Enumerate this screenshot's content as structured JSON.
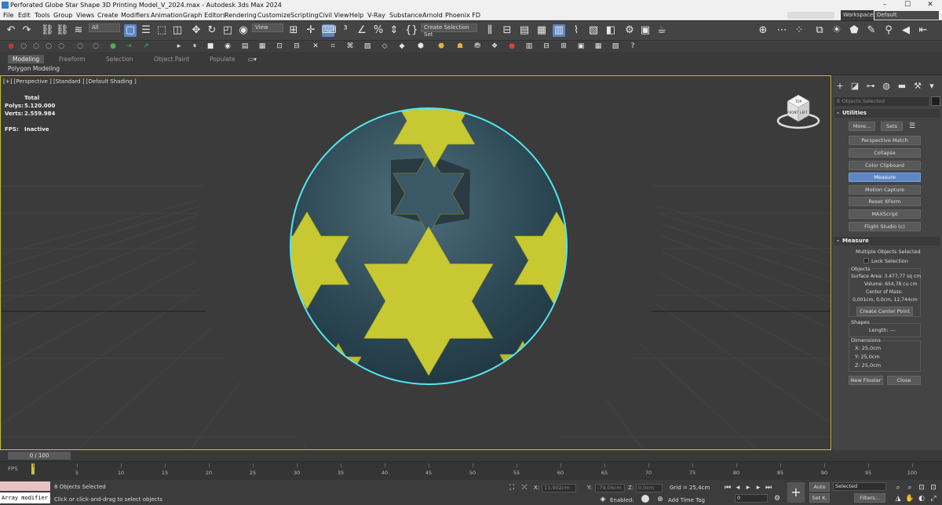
{
  "window": {
    "title": "Perforated Globe Star Shape 3D Printing Model_V_2024.max - Autodesk 3ds Max 2024",
    "controls": {
      "minimize": "–",
      "maximize": "☐",
      "close": "✕"
    }
  },
  "menu": {
    "items": [
      "File",
      "Edit",
      "Tools",
      "Group",
      "Views",
      "Create",
      "Modifiers",
      "Animation",
      "Graph Editors",
      "Rendering",
      "Customize",
      "Scripting",
      "Civil View",
      "Help",
      "V-Ray",
      "Substance",
      "Arnold",
      "Phoenix FD"
    ],
    "workspaces_label": "Workspaces:",
    "workspace_value": "Default"
  },
  "toolbar": {
    "selection_filter": "All",
    "reference_coord": "View",
    "named_selection": "Create Selection Set",
    "axis_labels": [
      "X",
      "Y",
      "Z",
      "XY",
      "XY"
    ]
  },
  "ribbon": {
    "tabs": [
      "Modeling",
      "Freeform",
      "Selection",
      "Object Paint",
      "Populate"
    ],
    "active_tab": "Modeling",
    "sub_label": "Polygon Modeling"
  },
  "viewport": {
    "label": "[+] [Perspective ] [Standard ] [Default Shading ]",
    "stats": {
      "total_label": "Total",
      "polys_label": "Polys:",
      "polys_value": "5.120.000",
      "verts_label": "Verts:",
      "verts_value": "2.559.984",
      "fps_label": "FPS:",
      "fps_value": "Inactive"
    },
    "colors": {
      "sphere": "#2e4a56",
      "stars": "#c7c832",
      "outline": "#52e6f2"
    },
    "viewcube_labels": [
      "TOP",
      "FRONT",
      "LEFT"
    ]
  },
  "command_panel": {
    "selection_info": "8 Objects Selected",
    "utilities": {
      "header": "Utilities",
      "more_button": "More...",
      "sets_button": "Sets",
      "buttons": [
        "Perspective Match",
        "Collapse",
        "Color Clipboard",
        "Measure",
        "Motion Capture",
        "Reset XForm",
        "MAXScript",
        "Flight Studio (c)"
      ],
      "active_button": "Measure"
    },
    "measure": {
      "header": "Measure",
      "selection_text": "Multiple Objects Selected",
      "lock_selection": "Lock Selection",
      "objects_label": "Objects",
      "surface_area": "Surface Area: 3.477,77 sq cm",
      "volume": "Volume: 654,78 cu cm",
      "center_label": "Center of Mass:",
      "center_value": "0,001cm, 0,0cm, 12,744cm",
      "center_button": "Create Center Point",
      "shapes_label": "Shapes",
      "length": "Length: ---",
      "dimensions_label": "Dimensions",
      "dim_x": "X:   25,0cm",
      "dim_y": "Y:   25,0cm",
      "dim_z": "Z:   25,0cm",
      "new_floater": "New Floater",
      "close": "Close"
    }
  },
  "timeline": {
    "slider_label": "0 / 100",
    "fps_label": "FPS",
    "ticks": [
      "0",
      "5",
      "10",
      "15",
      "20",
      "25",
      "30",
      "35",
      "40",
      "45",
      "50",
      "55",
      "60",
      "65",
      "70",
      "75",
      "80",
      "85",
      "90",
      "95",
      "100"
    ]
  },
  "status": {
    "maxscript_label": "Array modifier",
    "selected": "8 Objects Selected",
    "prompt": "Click or click-and-drag to select objects",
    "x_label": "X:",
    "x_value": "13,902cm",
    "y_label": "Y:",
    "y_value": "-79,06cm",
    "z_label": "Z:",
    "z_value": "0,0cm",
    "grid": "Grid = 25,4cm",
    "enabled_label": "Enabled:",
    "add_time_tag": "Add Time Tag",
    "auto_button": "Auto",
    "setkey_button": "Set K.",
    "selected_dropdown": "Selected",
    "filters_button": "Filters...",
    "frame_value": "0"
  }
}
